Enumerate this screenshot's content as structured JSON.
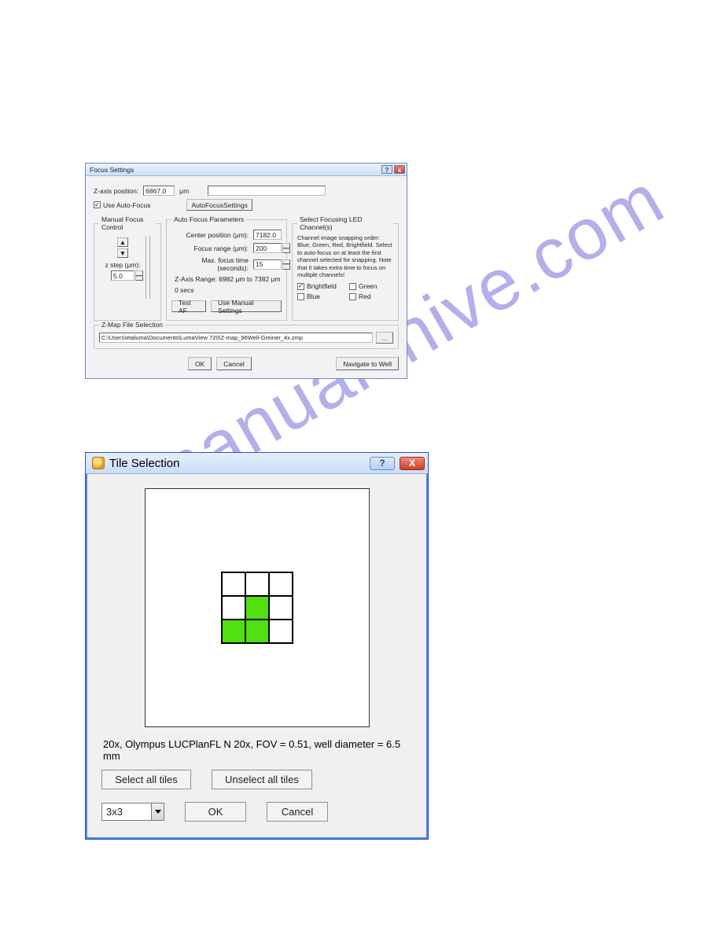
{
  "watermark": "manualshive.com",
  "focus": {
    "title": "Focus Settings",
    "z_axis_label": "Z-axis position:",
    "z_axis_value": "6867.0",
    "z_axis_unit": "μm",
    "use_af_label": "Use Auto-Focus",
    "use_af_checked": true,
    "af_settings_btn": "AutoFocusSettings",
    "mfc": {
      "legend": "Manual Focus Control",
      "z_step_label": "z step (μm):",
      "z_step_value": "5.0"
    },
    "afp": {
      "legend": "Auto Focus Parameters",
      "center_label": "Center position (μm):",
      "center_value": "7182.0",
      "range_label": "Focus range (μm):",
      "range_value": "200",
      "maxtime_label": "Max. focus time (seconds):",
      "maxtime_value": "15",
      "zrange_text": "Z-Axis Range: 6982 μm to 7382 μm",
      "secs_text": "0 secs",
      "test_btn": "Test AF",
      "manual_btn": "Use Manual Settings"
    },
    "led": {
      "legend": "Select Focusing LED Channel(s)",
      "help": "Channel image snapping order: Blue, Green, Red, Brightfield. Select to auto-focus on at least the first channel selected for snapping. Note that it takes extra time to focus on multiple channels!",
      "brightfield": {
        "label": "Brightfield",
        "checked": true
      },
      "green": {
        "label": "Green",
        "checked": false
      },
      "blue": {
        "label": "Blue",
        "checked": false
      },
      "red": {
        "label": "Red",
        "checked": false
      }
    },
    "zmap": {
      "legend": "Z-Map File Selection",
      "path": "C:\\Users\\etaluma\\Documents\\LumaView 720\\Z-map_96Well-Greiner_4x.zmp",
      "browse": "..."
    },
    "ok": "OK",
    "cancel": "Cancel",
    "nav": "Navigate to Well"
  },
  "tile": {
    "title": "Tile Selection",
    "grid_dim": 3,
    "selected_cells": [
      4,
      6,
      7
    ],
    "info": "20x, Olympus LUCPlanFL N 20x, FOV = 0.51, well diameter = 6.5 mm",
    "select_all": "Select all tiles",
    "unselect_all": "Unselect all tiles",
    "grid_combo": "3x3",
    "ok": "OK",
    "cancel": "Cancel"
  }
}
